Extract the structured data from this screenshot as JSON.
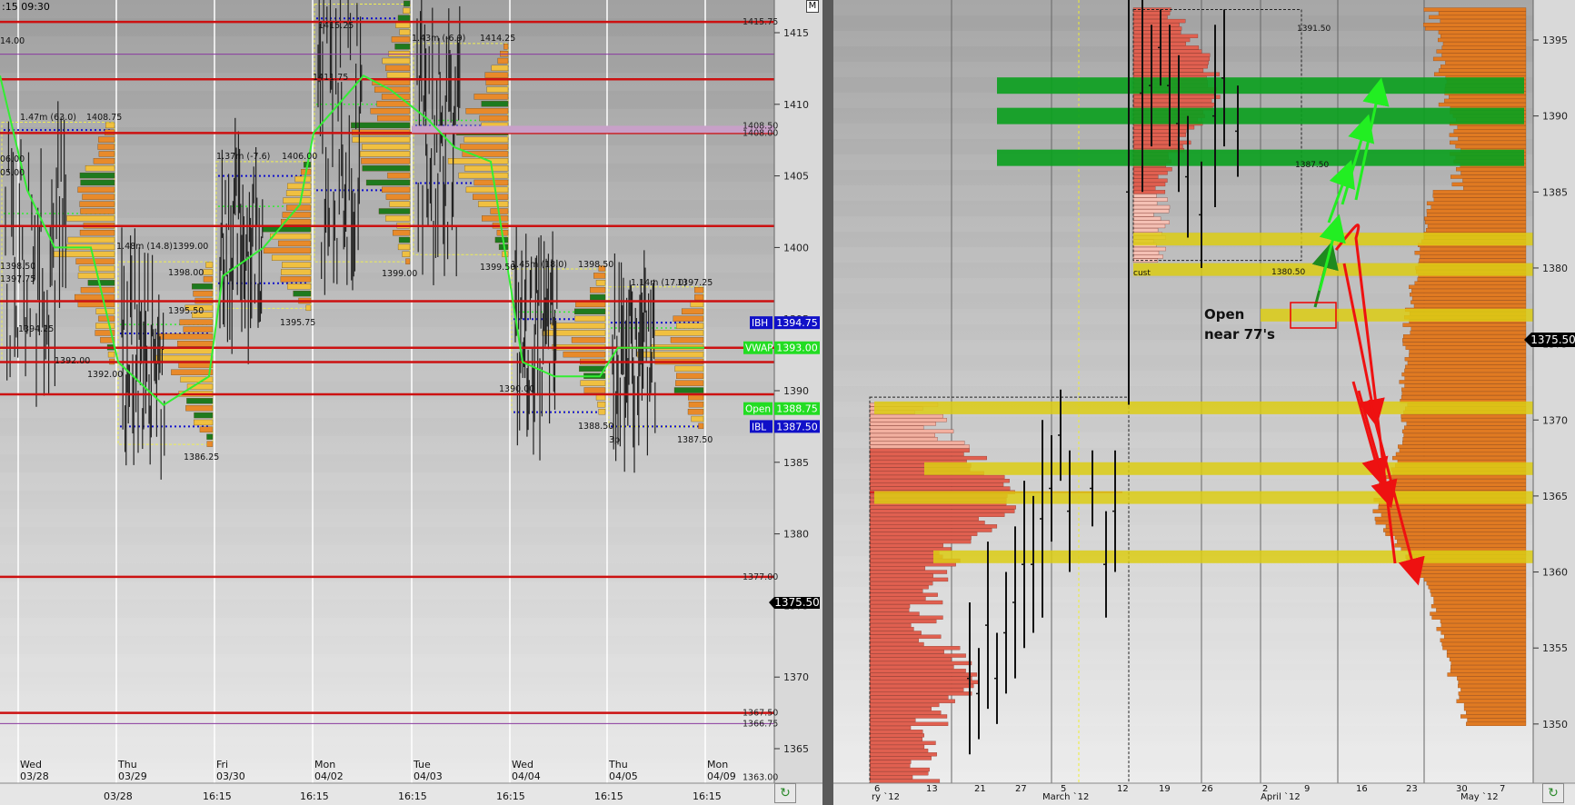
{
  "left_chart": {
    "corner_label": ":15  09:30",
    "m_button": "M",
    "price_axis_ticks": [
      "1415",
      "1410",
      "1405",
      "1400",
      "1395",
      "1390",
      "1385",
      "1380",
      "1375",
      "1370",
      "1365"
    ],
    "level_labels": [
      {
        "text": "1415.75"
      },
      {
        "text": "1408.50"
      },
      {
        "text": "1408.00"
      },
      {
        "text": "1377.00"
      },
      {
        "text": "1367.50"
      },
      {
        "text": "1366.75"
      },
      {
        "text": "1363.00"
      }
    ],
    "badges": [
      {
        "text": "IBH",
        "value": "1394.75",
        "color": "#1010c8"
      },
      {
        "text": "VWAP",
        "value": "1393.00",
        "color": "#22dd22"
      },
      {
        "text": "Open",
        "value": "1388.75",
        "color": "#22dd22"
      },
      {
        "text": "IBL",
        "value": "1387.50",
        "color": "#1010c8"
      }
    ],
    "current_price": "1375.50",
    "session_labels": [
      {
        "text": "14.00"
      },
      {
        "text": "1.47m (63.0)"
      },
      {
        "text": "1408.75"
      },
      {
        "text": "06.00"
      },
      {
        "text": "05.00"
      },
      {
        "text": "1398.50"
      },
      {
        "text": "1397.75"
      },
      {
        "text": "1394.25"
      },
      {
        "text": "1392.00"
      },
      {
        "text": "1392.00"
      },
      {
        "text": "1.48m (14.8)"
      },
      {
        "text": "1399.00"
      },
      {
        "text": "1395.50"
      },
      {
        "text": "1386.25"
      },
      {
        "text": "1.37m (-7.6)"
      },
      {
        "text": "1406.00"
      },
      {
        "text": "1395.75"
      },
      {
        "text": "1398.00"
      },
      {
        "text": "1415.25"
      },
      {
        "text": "1411.75"
      },
      {
        "text": "1.43m (-6.9)"
      },
      {
        "text": "1414.25"
      },
      {
        "text": "1399.00"
      },
      {
        "text": "1399.50"
      },
      {
        "text": "1.45m (18.0)"
      },
      {
        "text": "1398.50"
      },
      {
        "text": "1390.00"
      },
      {
        "text": "1388.50"
      },
      {
        "text": "1.14m (17.0)"
      },
      {
        "text": "1397.25"
      },
      {
        "text": "3p"
      },
      {
        "text": "1387.50"
      }
    ],
    "day_labels": [
      {
        "day": "Wed",
        "date": "03/28"
      },
      {
        "day": "Thu",
        "date": "03/29"
      },
      {
        "day": "Fri",
        "date": "03/30"
      },
      {
        "day": "Mon",
        "date": "04/02"
      },
      {
        "day": "Tue",
        "date": "04/03"
      },
      {
        "day": "Wed",
        "date": "04/04"
      },
      {
        "day": "Thu",
        "date": "04/05"
      },
      {
        "day": "Mon",
        "date": "04/09"
      }
    ],
    "time_axis_labels": [
      "03/28",
      "16:15",
      "16:15",
      "16:15",
      "16:15",
      "16:15",
      "16:15"
    ]
  },
  "right_chart": {
    "price_axis_ticks": [
      "1395",
      "1390",
      "1385",
      "1380",
      "1375",
      "1370",
      "1365",
      "1360",
      "1355",
      "1350"
    ],
    "current_price": "1375.50",
    "annotation": {
      "line1": "Open",
      "line2": "near 77's"
    },
    "profile_labels": [
      {
        "text": "1387.50"
      },
      {
        "text": "1380.50"
      },
      {
        "text": "cust"
      },
      {
        "text": "1391.50"
      }
    ],
    "date_axis_labels": [
      "ry `12",
      "6",
      "13",
      "21",
      "27",
      "March `12",
      "5",
      "12",
      "19",
      "26",
      "April `12",
      "2",
      "9",
      "16",
      "23",
      "30",
      "7",
      "May `12"
    ],
    "colors": {
      "green_band": "#0aa01e",
      "yellow_band": "#d2c81e",
      "up_arrow": "#22ee22",
      "down_arrow": "#ee1111"
    }
  }
}
